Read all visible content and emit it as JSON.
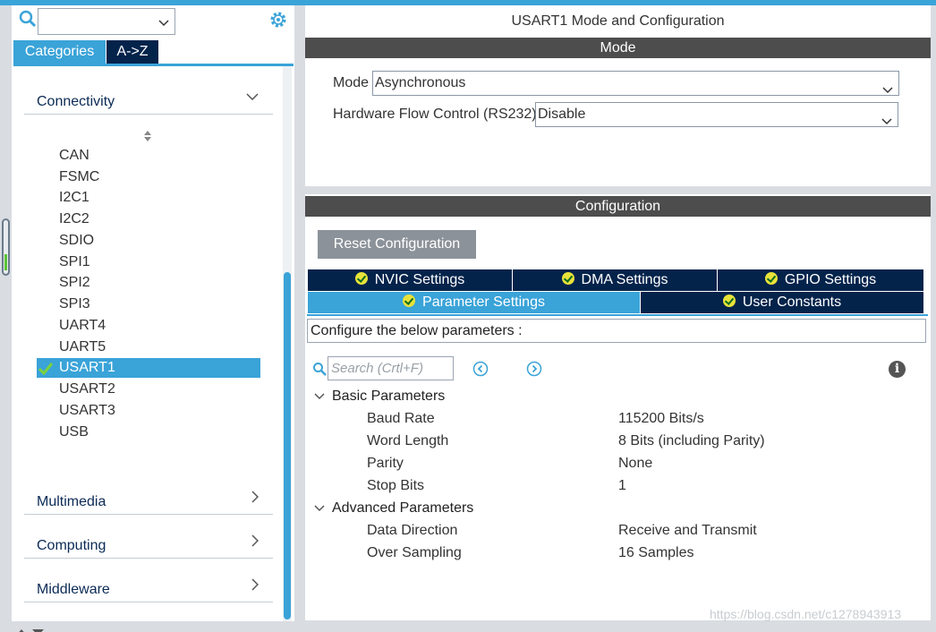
{
  "sidebar": {
    "search_value": "",
    "tabs": [
      "Categories",
      "A->Z"
    ],
    "categories": {
      "connectivity": "Connectivity",
      "multimedia": "Multimedia",
      "computing": "Computing",
      "middleware": "Middleware"
    },
    "items": [
      "CAN",
      "FSMC",
      "I2C1",
      "I2C2",
      "SDIO",
      "SPI1",
      "SPI2",
      "SPI3",
      "UART4",
      "UART5",
      "USART1",
      "USART2",
      "USART3",
      "USB"
    ],
    "selected": "USART1"
  },
  "main": {
    "title": "USART1 Mode and Configuration",
    "mode_header": "Mode",
    "mode_label": "Mode",
    "mode_value": "Asynchronous",
    "flow_label": "Hardware Flow Control (RS232)",
    "flow_value": "Disable",
    "config_header": "Configuration",
    "reset_button": "Reset Configuration",
    "tabs": [
      "NVIC Settings",
      "DMA Settings",
      "GPIO Settings",
      "Parameter Settings",
      "User Constants"
    ],
    "config_prompt": "Configure the below parameters :",
    "search_placeholder": "Search (Crtl+F)",
    "basic_group": "Basic Parameters",
    "basic_params": [
      {
        "name": "Baud Rate",
        "value": "115200 Bits/s"
      },
      {
        "name": "Word Length",
        "value": "8 Bits (including Parity)"
      },
      {
        "name": "Parity",
        "value": "None"
      },
      {
        "name": "Stop Bits",
        "value": "1"
      }
    ],
    "advanced_group": "Advanced Parameters",
    "advanced_params": [
      {
        "name": "Data Direction",
        "value": "Receive and Transmit"
      },
      {
        "name": "Over Sampling",
        "value": "16 Samples"
      }
    ]
  },
  "watermark": "https://blog.csdn.net/c1278943913",
  "colors": {
    "accent": "#3aa3d8",
    "navy": "#03234b",
    "bar": "#4d4d4d"
  }
}
